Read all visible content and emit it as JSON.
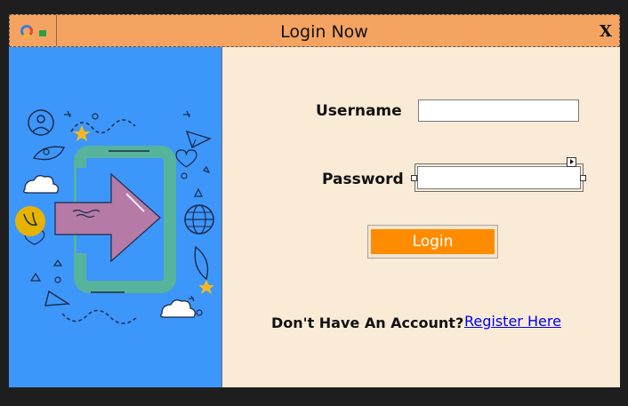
{
  "window": {
    "title": "Login Now",
    "close_label": "X",
    "background": "#faebd7",
    "titlebar_color": "#f4a460"
  },
  "illustration": {
    "background": "#3d96fa",
    "icon": "login-arrow-illustration"
  },
  "form": {
    "username_label": "Username",
    "username_value": "",
    "password_label": "Password",
    "password_value": "",
    "login_label": "Login",
    "login_color": "#ff8c00"
  },
  "footer": {
    "no_account_text": "Don't Have An Account?",
    "register_link": "Register Here"
  }
}
